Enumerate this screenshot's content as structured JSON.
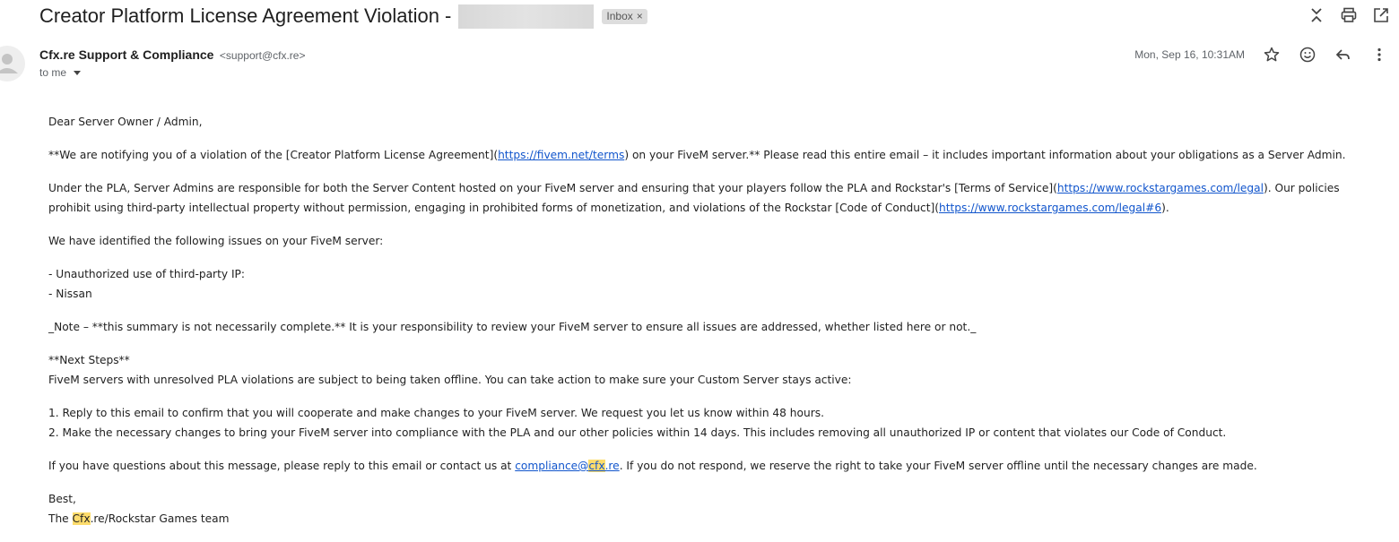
{
  "subject": {
    "title": "Creator Platform License Agreement Violation -",
    "label": "Inbox",
    "label_close": "×"
  },
  "header_icons": [
    "collapse-icon",
    "print-icon",
    "open-in-new-window-icon"
  ],
  "sender": {
    "name": "Cfx.re Support & Compliance",
    "email": "<support@cfx.re>",
    "to": "to me"
  },
  "meta": {
    "date": "Mon, Sep 16, 10:31AM",
    "icons": [
      "star-icon",
      "emoji-icon",
      "reply-icon",
      "more-icon"
    ]
  },
  "body": {
    "greeting": "Dear Server Owner / Admin,",
    "p1_a": "**We are notifying you of a violation of the [Creator Platform License Agreement](",
    "p1_link": "https://fivem.net/terms",
    "p1_b": ") on your FiveM server.** Please read this entire email – it includes important information about your obligations as a Server Admin.",
    "p2_a": "Under the PLA, Server Admins are responsible for both the Server Content hosted on your FiveM server and ensuring that your players follow the PLA and Rockstar's [Terms of Service](",
    "p2_link1": "https://www.rockstargames.com/legal",
    "p2_b": "). Our policies prohibit using third-party intellectual property without permission, engaging in prohibited forms of monetization, and violations of the Rockstar [Code of Conduct](",
    "p2_link2": "https://www.rockstargames.com/legal#6",
    "p2_c": ").",
    "p3": "We have identified the following issues on your FiveM server:",
    "issue1": "- Unauthorized use of third-party IP:",
    "issue2": "- Nissan",
    "note": "_Note – **this summary is not necessarily complete.** It is your responsibility to review your FiveM server to ensure all issues are addressed, whether listed here or not._",
    "next_heading": "**Next Steps**",
    "next_text": "FiveM servers with unresolved PLA violations are subject to being taken offline. You can take action to make sure your Custom Server stays active:",
    "step1": "1. Reply to this email to confirm that you will cooperate and make changes to your FiveM server. We request you let us know within 48 hours.",
    "step2": "2. Make the necessary changes to bring your FiveM server into compliance with the PLA and our other policies within 14 days. This includes removing all unauthorized IP or content that violates our Code of Conduct.",
    "contact_a": "If you have questions about this message, please reply to this email or contact us at ",
    "contact_link_a": "compliance@",
    "contact_link_hl": "cfx",
    "contact_link_b": ".re",
    "contact_b": ". If you do not respond, we reserve the right to take your FiveM server offline until the necessary changes are made.",
    "signoff": "Best,",
    "team_a": "The ",
    "team_hl": "Cfx",
    "team_b": ".re/Rockstar Games team"
  }
}
